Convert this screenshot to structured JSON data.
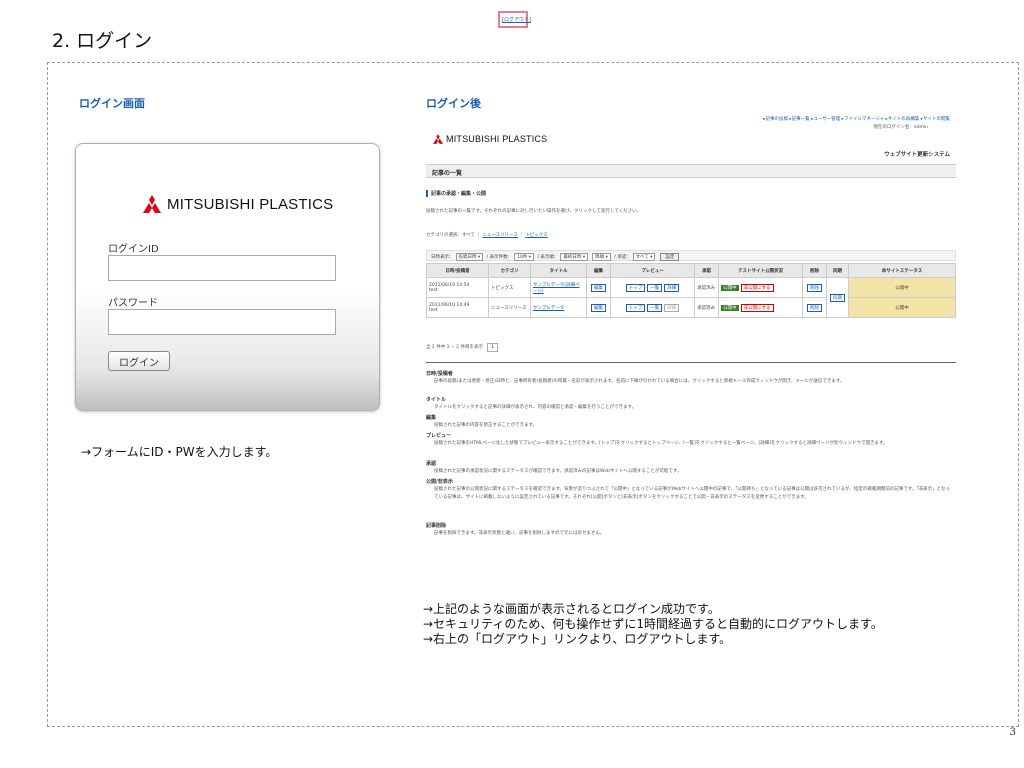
{
  "doc": {
    "title": "2. ログイン",
    "page_number": "3"
  },
  "left": {
    "section_title": "ログイン画面",
    "logo_text": "MITSUBISHI PLASTICS",
    "id_label": "ログインID",
    "password_label": "パスワード",
    "login_button": "ログイン",
    "note": "→フォームにID・PWを入力します。"
  },
  "right": {
    "section_title": "ログイン後",
    "shot": {
      "logo_text": "MITSUBISHI PLASTICS",
      "top_links": "▸記事の投稿 ▸記事一覧 ▸ユーザー管理 ▸ファイルマネージャ ▸サイトの再構築 ▸サイトの閲覧",
      "user_line": "現在のログイン名：admin",
      "logout_link": "[ログアウト]",
      "system_name": "ウェブサイト更新システム",
      "page_bar": "記事の一覧",
      "subhead": "記事の承認・編集・公開",
      "intro": "投稿された記事の一覧です。それぞれの記事に対し行いたい操作を選び、クリックして実行してください。",
      "category_prefix": "カテゴリの選択：すべて ｜ ",
      "category_link1": "ニュースリリース",
      "category_sep": " ｜ ",
      "category_link2": "トピックス",
      "filter": {
        "l1": "日時表示：",
        "s1": "投稿日時 ▾",
        "l2": " / 表示件数：",
        "s2": "10件 ▾",
        "l3": " / 表示順：",
        "s3": "最終日時 ▾",
        "s4": "降順 ▾",
        "l4": " / 承認：",
        "s5": "すべて ▾",
        "button": "設定"
      },
      "table_headers": [
        "日時/投稿者",
        "カテゴリ",
        "タイトル",
        "編集",
        "プレビュー",
        "承認",
        "テストサイト公開状況",
        "削除",
        "同期",
        "本サイトステータス"
      ],
      "rows": [
        {
          "date": "2011/06/10 14:54",
          "author": "test",
          "category": "トピックス",
          "title": "サンプルデータ(詳細ページ)",
          "edit": "編集",
          "prev1": "トップ",
          "prev2": "一覧",
          "prev3": "詳細",
          "approval": "承認済み",
          "test_status": "公開中",
          "test_button": "非公開にする",
          "delete": "削除",
          "status": "公開中"
        },
        {
          "date": "2011/06/10 14:49",
          "author": "test",
          "category": "ニュースリリース",
          "title": "サンプルデータ",
          "edit": "編集",
          "prev1": "トップ",
          "prev2": "一覧",
          "prev3": "詳細",
          "approval": "承認済み",
          "test_status": "公開中",
          "test_button": "非公開にする",
          "delete": "削除",
          "status": "公開中"
        }
      ],
      "sync_button": "同期",
      "pager_text": "全 2 件中 1 − 2 件目を表示",
      "pager_page": "1",
      "help": [
        {
          "term": "日時/投稿者",
          "desc": "記事の投稿(または更新・修正)日時と、記事所有者(投稿者)の所属・名前が表示されます。名前に下線が引かれている場合には、クリックすると新規メール作成ウィンドウが開き、メールが送信できます。"
        },
        {
          "term": "タイトル",
          "desc": "タイトルをクリックすると記事の詳細が表示され、内容の確認と承認・編集を行うことができます。"
        },
        {
          "term": "編集",
          "desc": "投稿された記事の内容を修正することができます。"
        },
        {
          "term": "プレビュー",
          "desc": "投稿された記事をHTMLページ化した状態でプレビュー表示することができます。[トップ]をクリックするとトップページ、[一覧]をクリックすると一覧ページ、[詳細]をクリックすると詳細ページが別ウィンドウで開きます。"
        },
        {
          "term": "承認",
          "desc": "投稿された記事の承認状況に関するステータスが確認できます。承認済みの記事はWebサイトへ公開することが可能です。"
        },
        {
          "term": "公開/非表示",
          "desc": "投稿された記事の公開状況に関するステータスを確認できます。背景が塗りつぶされて「公開中」となっている記事がWebサイトへ公開中の記事で、「公開待ち」となっている記事は公開は許可されているが、指定の掲載期間前の記事です。「非表示」となっている記事は、サイトに掲載しないように設定されている記事です。それぞれ[公開]ボタンと[非表示]ボタンをクリックすることで公開・非表示のステータスを変更することができます。"
        },
        {
          "term": "記事削除",
          "desc": "記事を削除できます。非表示状態と違い、記事を削除しますので元には戻せません。"
        }
      ]
    },
    "notes": [
      "→上記のような画面が表示されるとログイン成功です。",
      "→セキュリティのため、何も操作せずに1時間経過すると自動的にログアウトします。",
      "→右上の「ログアウト」リンクより、ログアウトします。"
    ]
  },
  "colors": {
    "accent": "#1a5fb4",
    "logo_red": "#e60012",
    "highlight": "#ea7a8e",
    "published_bg": "#f2e3a6"
  }
}
